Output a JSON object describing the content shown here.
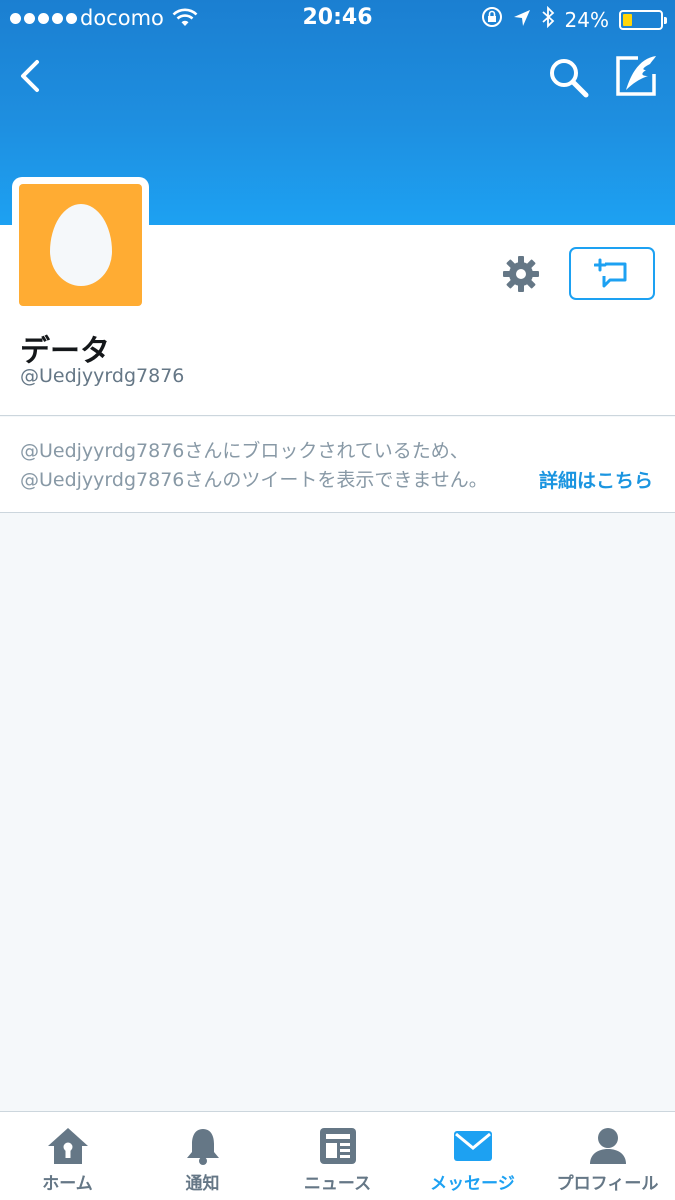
{
  "status_bar": {
    "carrier": "docomo",
    "time": "20:46",
    "battery": "24%",
    "battery_level": 0.24
  },
  "profile": {
    "display_name": "データ",
    "handle": "@Uedjyyrdg7876"
  },
  "blocked_notice": {
    "line1": "@Uedjyyrdg7876さんにブロックされているため、",
    "line2": "@Uedjyyrdg7876さんのツイートを表示できません。",
    "link": "詳細はこちら"
  },
  "tabs": [
    {
      "label": "ホーム",
      "icon": "home-icon",
      "active": false
    },
    {
      "label": "通知",
      "icon": "bell-icon",
      "active": false
    },
    {
      "label": "ニュース",
      "icon": "news-icon",
      "active": false
    },
    {
      "label": "メッセージ",
      "icon": "envelope-icon",
      "active": true
    },
    {
      "label": "プロフィール",
      "icon": "person-icon",
      "active": false
    }
  ],
  "colors": {
    "accent": "#1da1f2",
    "avatar_bg": "#ffac33",
    "inactive_icon": "#657786"
  }
}
